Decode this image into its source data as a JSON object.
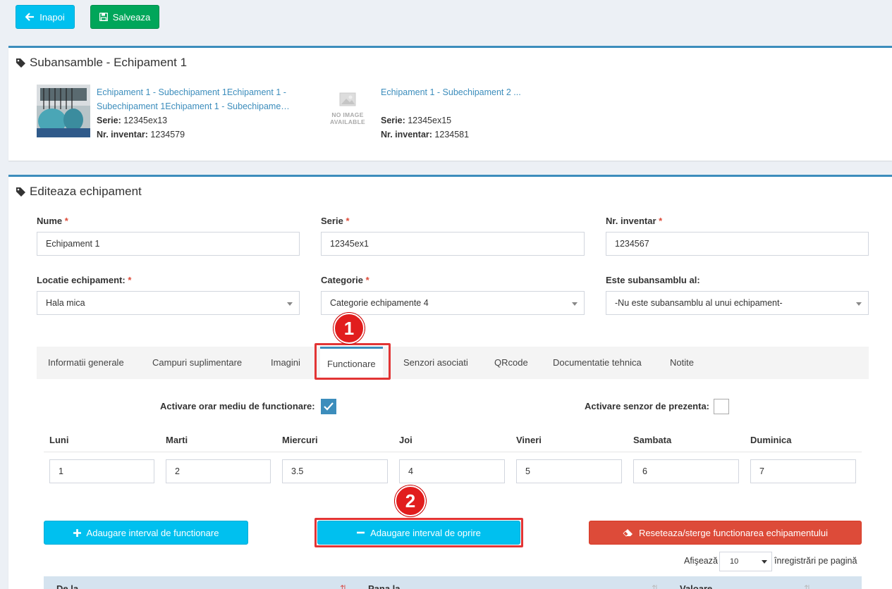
{
  "toolbar": {
    "back_label": "Inapoi",
    "save_label": "Salveaza"
  },
  "subansamble": {
    "title": "Subansamble - Echipament 1",
    "items": [
      {
        "link_line1": "Echipament 1 - Subechipament 1Echipament 1 -",
        "link_line2": "Subechipament 1Echipament 1 - Subechipame…",
        "serie_label": "Serie:",
        "serie": "12345ex13",
        "inv_label": "Nr. inventar:",
        "inv": "1234579"
      },
      {
        "link_line1": "Echipament 1 - Subechipament 2 ...",
        "no_image_line1": "NO IMAGE",
        "no_image_line2": "AVAILABLE",
        "serie_label": "Serie:",
        "serie": "12345ex15",
        "inv_label": "Nr. inventar:",
        "inv": "1234581"
      }
    ]
  },
  "edit": {
    "title": "Editeaza echipament",
    "required_mark": "*",
    "fields": {
      "nume": {
        "label": "Nume",
        "value": "Echipament 1"
      },
      "serie": {
        "label": "Serie",
        "value": "12345ex1"
      },
      "inventar": {
        "label": "Nr. inventar",
        "value": "1234567"
      },
      "locatie": {
        "label": "Locatie echipament:",
        "value": "Hala mica"
      },
      "categorie": {
        "label": "Categorie",
        "value": "Categorie echipamente 4"
      },
      "subansamblu": {
        "label": "Este subansamblu al:",
        "value": "-Nu este subansamblu al unui echipament-"
      }
    },
    "tabs": [
      "Informatii generale",
      "Campuri suplimentare",
      "Imagini",
      "Functionare",
      "Senzori asociati",
      "QRcode",
      "Documentatie tehnica",
      "Notite"
    ],
    "active_tab": "Functionare",
    "annotations": [
      "1",
      "2"
    ],
    "functionare": {
      "orar_label": "Activare orar mediu de functionare:",
      "orar_checked": true,
      "senzor_label": "Activare senzor de prezenta:",
      "senzor_checked": false,
      "days": [
        {
          "label": "Luni",
          "value": "1"
        },
        {
          "label": "Marti",
          "value": "2"
        },
        {
          "label": "Miercuri",
          "value": "3.5"
        },
        {
          "label": "Joi",
          "value": "4"
        },
        {
          "label": "Vineri",
          "value": "5"
        },
        {
          "label": "Sambata",
          "value": "6"
        },
        {
          "label": "Duminica",
          "value": "7"
        }
      ],
      "add_interval_label": "Adaugare interval de functionare",
      "add_stop_label": "Adaugare interval de oprire",
      "reset_label": "Reseteaza/sterge functionarea echipamentului",
      "length_before": "Afişează",
      "length_value": "10",
      "length_after": "înregistrări pe pagină",
      "columns": [
        "De la",
        "Pana la",
        "Valoare"
      ]
    }
  },
  "colors": {
    "primary": "#3c8dbc",
    "info": "#00c0ef",
    "success": "#00a65a",
    "danger": "#dd4b39",
    "annotation": "#e11d1d"
  },
  "icons": [
    "arrow-left-icon",
    "floppy-icon",
    "tag-icon",
    "checkmark-icon",
    "plus-icon",
    "minus-icon",
    "eraser-icon",
    "sort-icon",
    "no-image-icon"
  ]
}
